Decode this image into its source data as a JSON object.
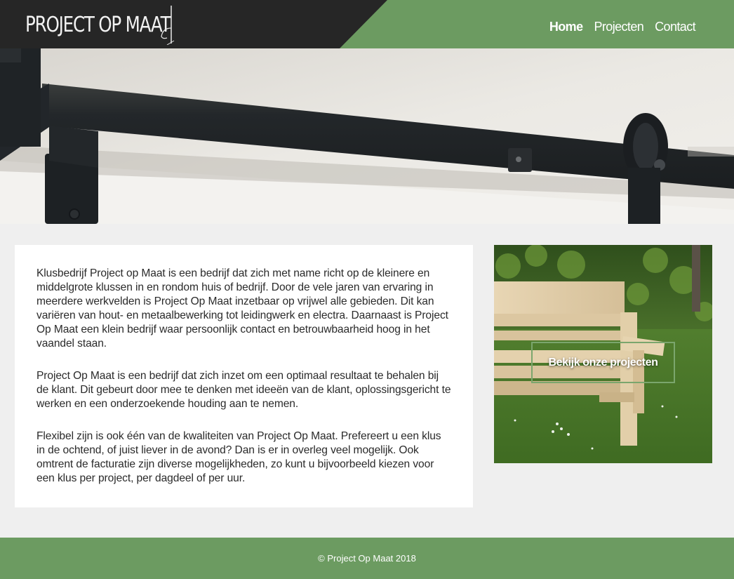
{
  "brand": {
    "logo_text": "PROJECT OP MAAT",
    "logo_icon": "logo-mark"
  },
  "nav": {
    "items": [
      {
        "label": "Home",
        "active": true
      },
      {
        "label": "Projecten",
        "active": false
      },
      {
        "label": "Contact",
        "active": false
      }
    ]
  },
  "hero": {
    "image": "sliding-door-rail-photo"
  },
  "content": {
    "paragraphs": [
      "Klusbedrijf Project op Maat is een bedrijf dat zich met name richt op de kleinere en middelgrote klussen in en rondom huis of bedrijf. Door de vele jaren van ervaring in meerdere werkvelden is Project Op Maat inzetbaar op vrijwel alle gebieden. Dit kan variëren van hout- en metaalbewerking tot leidingwerk en electra. Daarnaast is Project Op Maat een klein bedrijf waar persoonlijk contact en betrouwbaarheid hoog in het vaandel staan.",
      "Project Op Maat is een bedrijf dat zich inzet om een optimaal resultaat te behalen bij de klant. Dit gebeurt door mee te denken met ideeën van de klant, oplossingsgericht te werken en een onderzoekende houding aan te nemen.",
      "Flexibel zijn is ook één van de kwaliteiten van Project Op Maat. Prefereert u een klus in de ochtend, of juist liever in de avond? Dan is er in overleg veel mogelijk. Ook omtrent de facturatie zijn diverse mogelijkheden, zo kunt u bijvoorbeeld kiezen voor een klus per project, per dagdeel of per uur."
    ]
  },
  "side": {
    "image": "wooden-bench-photo",
    "cta_label": "Bekijk onze projecten"
  },
  "footer": {
    "copyright": "© Project Op Maat 2018"
  },
  "colors": {
    "accent": "#6c9b61",
    "dark": "#262626",
    "background": "#efefef"
  }
}
